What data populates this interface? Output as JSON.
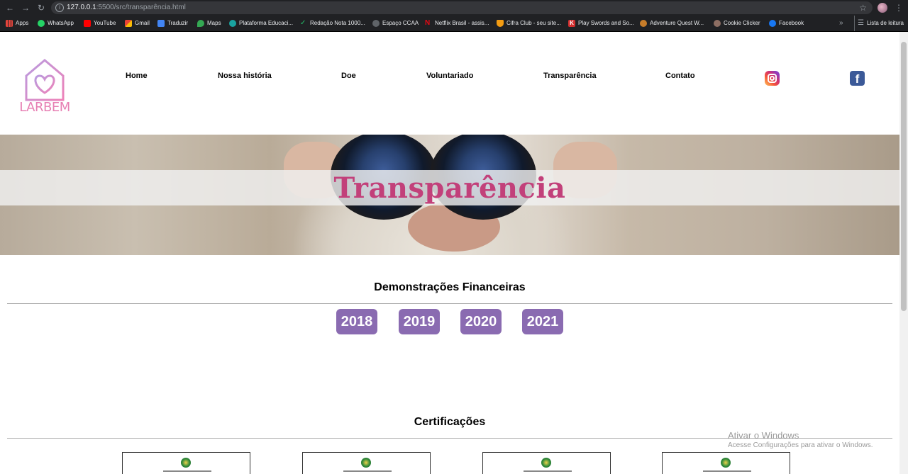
{
  "browser": {
    "url_host": "127.0.0.1",
    "url_path": ":5500/src/transparência.html",
    "bookmarks": [
      {
        "label": "Apps",
        "color": "#e8eaed"
      },
      {
        "label": "WhatsApp",
        "color": "#25d366"
      },
      {
        "label": "YouTube",
        "color": "#ff0000"
      },
      {
        "label": "Gmail",
        "color": "#ea4335"
      },
      {
        "label": "Traduzir",
        "color": "#4285f4"
      },
      {
        "label": "Maps",
        "color": "#34a853"
      },
      {
        "label": "Plataforma Educaci...",
        "color": "#1aa3a0"
      },
      {
        "label": "Redação Nota 1000...",
        "color": "#23c26b"
      },
      {
        "label": "Espaço CCAA",
        "color": "#9aa0a6"
      },
      {
        "label": "Netflix Brasil - assis...",
        "color": "#e50914"
      },
      {
        "label": "Cifra Club - seu site...",
        "color": "#f39c12"
      },
      {
        "label": "Play Swords and So...",
        "color": "#d32f2f"
      },
      {
        "label": "Adventure Quest W...",
        "color": "#c77d2a"
      },
      {
        "label": "Cookie Clicker",
        "color": "#8d6e63"
      },
      {
        "label": "Facebook",
        "color": "#1877f2"
      }
    ],
    "reading_list": "Lista de leitura"
  },
  "site": {
    "logo_text": "LARBEM",
    "nav": [
      "Home",
      "Nossa história",
      "Doe",
      "Voluntariado",
      "Transparência",
      "Contato"
    ],
    "hero_title": "Transparência",
    "financial_title": "Demonstrações Financeiras",
    "years": [
      "2018",
      "2019",
      "2020",
      "2021"
    ],
    "cert_title": "Certificações"
  },
  "watermark": {
    "line1": "Ativar o Windows",
    "line2": "Acesse Configurações para ativar o Windows."
  },
  "colors": {
    "brand_pink": "#c2407a",
    "button_purple": "#8a6bb1"
  }
}
